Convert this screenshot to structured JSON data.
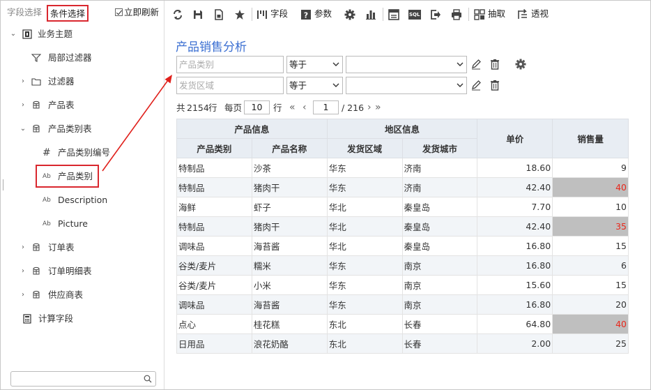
{
  "left_panel": {
    "tab_field": "字段选择",
    "tab_condition": "条件选择",
    "refresh_label": "立即刷新",
    "tree": [
      {
        "label": "业务主题",
        "icon": "business-theme-icon"
      },
      {
        "label": "局部过滤器",
        "icon": "local-filter-icon"
      },
      {
        "label": "过滤器",
        "icon": "folder-icon"
      },
      {
        "label": "产品表",
        "icon": "table-icon"
      },
      {
        "label": "产品类别表",
        "icon": "table-icon"
      },
      {
        "label": "产品类别编号",
        "icon": "number-field-icon"
      },
      {
        "label": "产品类别",
        "icon": "text-field-icon"
      },
      {
        "label": "Description",
        "icon": "text-field-icon"
      },
      {
        "label": "Picture",
        "icon": "text-field-icon"
      },
      {
        "label": "订单表",
        "icon": "table-icon"
      },
      {
        "label": "订单明细表",
        "icon": "table-icon"
      },
      {
        "label": "供应商表",
        "icon": "table-icon"
      },
      {
        "label": "计算字段",
        "icon": "calculator-icon"
      }
    ],
    "text_icon_glyph": "Ab",
    "number_icon_glyph": "#"
  },
  "toolbar": {
    "field_label": "字段",
    "param_label": "参数",
    "sql_label": "SQL",
    "extract_label": "抽取",
    "pivot_label": "透视"
  },
  "report": {
    "title": "产品销售分析",
    "filters": [
      {
        "placeholder": "产品类别",
        "operator": "等于",
        "value": ""
      },
      {
        "placeholder": "发货区域",
        "operator": "等于",
        "value": ""
      }
    ],
    "pager": {
      "total_prefix": "共",
      "total": "2154",
      "total_suffix": "行",
      "per_page_label": "每页",
      "per_page": "10",
      "row_label": "行",
      "current_page": "1",
      "total_pages": "/ 216"
    },
    "table": {
      "group_headers": [
        "产品信息",
        "地区信息",
        "单价",
        "销售量"
      ],
      "sub_headers": [
        "产品类别",
        "产品名称",
        "发货区域",
        "发货城市"
      ],
      "rows": [
        [
          "特制品",
          "沙茶",
          "华东",
          "济南",
          "18.60",
          "9"
        ],
        [
          "特制品",
          "猪肉干",
          "华东",
          "济南",
          "42.40",
          "40"
        ],
        [
          "海鲜",
          "虾子",
          "华北",
          "秦皇岛",
          "7.70",
          "10"
        ],
        [
          "特制品",
          "猪肉干",
          "华北",
          "秦皇岛",
          "42.40",
          "35"
        ],
        [
          "调味品",
          "海苔酱",
          "华北",
          "秦皇岛",
          "16.80",
          "15"
        ],
        [
          "谷类/麦片",
          "糯米",
          "华东",
          "南京",
          "16.80",
          "6"
        ],
        [
          "谷类/麦片",
          "小米",
          "华东",
          "南京",
          "15.60",
          "15"
        ],
        [
          "调味品",
          "海苔酱",
          "华东",
          "南京",
          "16.80",
          "20"
        ],
        [
          "点心",
          "桂花糕",
          "东北",
          "长春",
          "64.80",
          "40"
        ],
        [
          "日用品",
          "浪花奶酪",
          "东北",
          "长春",
          "2.00",
          "25"
        ]
      ],
      "highlighted_rows": [
        1,
        3,
        8
      ]
    }
  },
  "colors": {
    "accent_title": "#3b6fd2",
    "highlight_text": "#e8281c",
    "highlight_bg": "#bfbfbf",
    "annotation_red": "#d9272e"
  }
}
